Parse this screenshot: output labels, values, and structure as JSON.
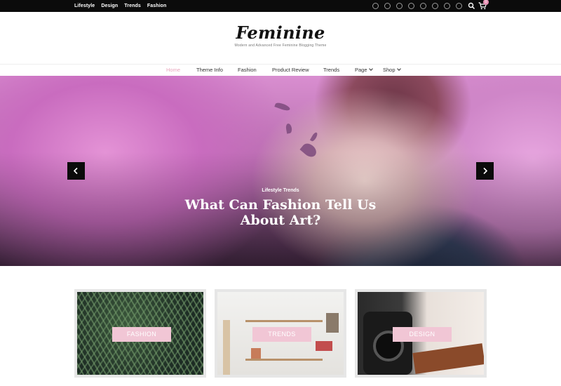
{
  "topbar": {
    "links": [
      "Lifestyle",
      "Design",
      "Trends",
      "Fashion"
    ],
    "cart_count": "0"
  },
  "brand": {
    "title": "Feminine",
    "tagline": "Modern and Advanced Free Feminine Blogging Theme"
  },
  "nav": {
    "items": [
      "Home",
      "Theme Info",
      "Fashion",
      "Product Review",
      "Trends",
      "Page",
      "Shop"
    ]
  },
  "hero": {
    "categories": "Lifestyle  Trends",
    "title": "What Can Fashion Tell Us About Art?"
  },
  "cards": [
    {
      "label": "FASHION"
    },
    {
      "label": "TRENDS"
    },
    {
      "label": "DESIGN"
    }
  ],
  "colors": {
    "accent": "#e9a6bd",
    "topbar": "#0b0b0b",
    "card_label": "#f1c6d5"
  }
}
